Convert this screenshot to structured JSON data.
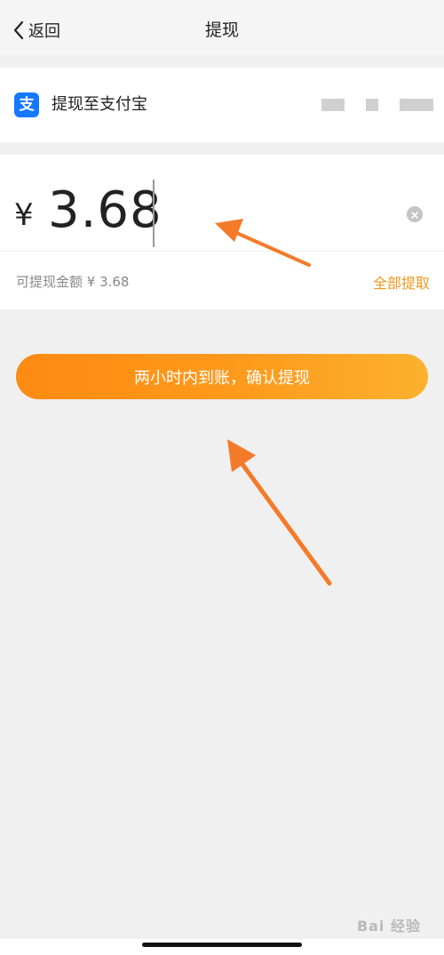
{
  "status_bar": {
    "left_text": "",
    "right_text": ""
  },
  "nav": {
    "back_label": "返回",
    "title": "提现"
  },
  "destination": {
    "label": "提现至支付宝",
    "logo_char": "支"
  },
  "amount": {
    "currency_symbol": "¥",
    "value": "3.68"
  },
  "balance": {
    "available_text": "可提现金额 ¥ 3.68",
    "withdraw_all_label": "全部提取"
  },
  "confirm": {
    "label": "两小时内到账，确认提现"
  },
  "watermark": {
    "text": "Bai 经验"
  },
  "colors": {
    "accent_orange": "#fd8a12",
    "alipay_blue": "#1677ff",
    "annotation_arrow": "#f47a2a",
    "withdraw_all": "#ef9a1c"
  }
}
